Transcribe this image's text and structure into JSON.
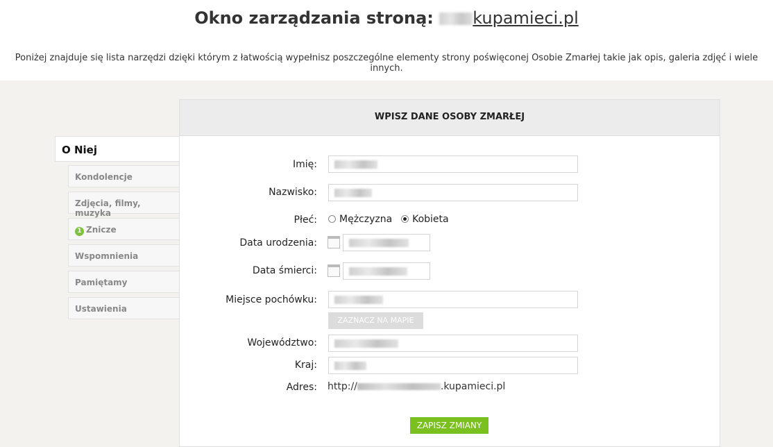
{
  "header": {
    "title_prefix": "Okno zarządzania stroną:",
    "title_domain": "kupamieci.pl",
    "intro": "Poniżej znajduje się lista narzędzi dzięki którym z łatwością wypełnisz poszczególne elementy strony poświęconej Osobie Zmarłej takie jak opis, galeria zdjęć i wiele innych."
  },
  "sidebar": {
    "active": "O Niej",
    "items": [
      {
        "label": "Kondolencje"
      },
      {
        "label": "Zdjęcia, filmy, muzyka"
      },
      {
        "label": "Znicze",
        "badge": "1"
      },
      {
        "label": "Wspomnienia"
      },
      {
        "label": "Pamiętamy"
      },
      {
        "label": "Ustawienia"
      }
    ]
  },
  "form": {
    "heading": "WPISZ DANE OSOBY ZMARŁEJ",
    "labels": {
      "imie": "Imię:",
      "nazwisko": "Nazwisko:",
      "plec": "Płeć:",
      "data_urodzenia": "Data urodzenia:",
      "data_smierci": "Data śmierci:",
      "miejsce": "Miejsce pochówku:",
      "wojewodztwo": "Województwo:",
      "kraj": "Kraj:",
      "adres": "Adres:"
    },
    "gender_options": [
      "Mężczyzna",
      "Kobieta"
    ],
    "gender_selected": "Kobieta",
    "map_button": "ZAZNACZ NA MAPIE",
    "address_prefix": "http://",
    "address_suffix": ".kupamieci.pl",
    "save_button": "ZAPISZ ZMIANY"
  },
  "colors": {
    "accent_green": "#7ac01e",
    "badge_green": "#7fc241",
    "page_bg": "#f4f2ee"
  }
}
